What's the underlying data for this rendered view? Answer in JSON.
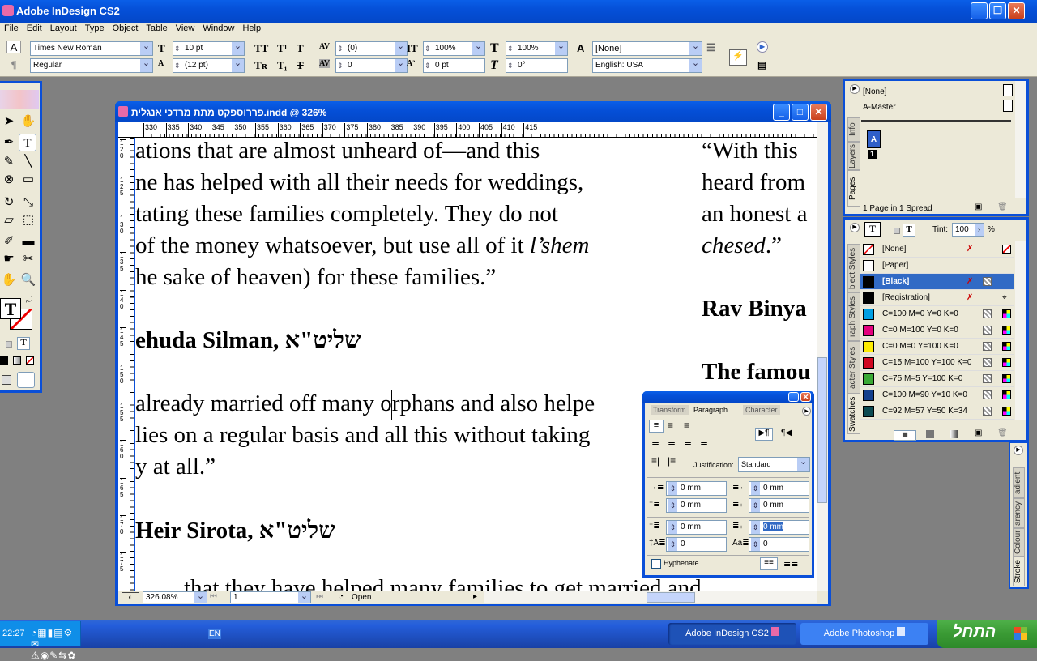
{
  "app": {
    "title": "Adobe InDesign CS2"
  },
  "menu": [
    "File",
    "Edit",
    "Layout",
    "Type",
    "Object",
    "Table",
    "View",
    "Window",
    "Help"
  ],
  "control": {
    "font": "Times New Roman",
    "style": "Regular",
    "size": "10 pt",
    "leading": "(12 pt)",
    "kerning": "(0)",
    "tracking": "0",
    "vscale": "100%",
    "baseline": "0 pt",
    "hscale": "100%",
    "skew": "0°",
    "char_style": "[None]",
    "language": "English: USA"
  },
  "document": {
    "title": "פררוספקט מתת מרדכי אנגלית.indd @ 326%",
    "hruler": [
      "330",
      "335",
      "340",
      "345",
      "350",
      "355",
      "360",
      "365",
      "370",
      "375",
      "380",
      "385",
      "390",
      "395",
      "400",
      "405",
      "410",
      "415"
    ],
    "vruler": [
      "120",
      "125",
      "130",
      "135",
      "140",
      "145",
      "150",
      "155",
      "160",
      "165",
      "170",
      "175"
    ],
    "left_lines": [
      "ations that are almost unheard of—and this",
      "ne has helped with all their needs for weddings,",
      "tating these families completely. They do not",
      " of the money whatsoever, but use all of it ",
      "he sake of heaven) for these families.”",
      "ehuda Silman, שליט\"א",
      "already married off many orphans and also helpe",
      "lies on a regular basis and all this without taking",
      "y at all.”",
      "Heir Sirota, שליט\"א",
      "that they have helped many families to get married and"
    ],
    "italic_word": "l’shem",
    "right_lines": [
      "“With this",
      "heard from",
      "an honest a",
      "chesed",
      ".”",
      "Rav Binya",
      "The famou"
    ],
    "zoom": "326.08%",
    "page": "1",
    "status": "Open"
  },
  "pages_panel": {
    "tabs": [
      "Pages",
      "Layers",
      "Info"
    ],
    "masters": [
      "[None]",
      "A-Master"
    ],
    "master_letter": "A",
    "page_num": "1",
    "footer": "1 Page in 1 Spread"
  },
  "swatches_panel": {
    "tabs": [
      "Swatches",
      "acter Styles",
      "raph Styles",
      "bject Styles"
    ],
    "tint_label": "Tint:",
    "tint": "100",
    "pct": "%",
    "items": [
      {
        "name": "[None]",
        "color": "#ffffff"
      },
      {
        "name": "[Paper]",
        "color": "#ffffff"
      },
      {
        "name": "[Black]",
        "color": "#000000"
      },
      {
        "name": "[Registration]",
        "color": "#000000"
      },
      {
        "name": "C=100 M=0 Y=0 K=0",
        "color": "#009fe3"
      },
      {
        "name": "C=0 M=100 Y=0 K=0",
        "color": "#e4007d"
      },
      {
        "name": "C=0 M=0 Y=100 K=0",
        "color": "#ffed00"
      },
      {
        "name": "C=15 M=100 Y=100 K=0",
        "color": "#d1081f"
      },
      {
        "name": "C=75 M=5 Y=100 K=0",
        "color": "#3aa935"
      },
      {
        "name": "C=100 M=90 Y=10 K=0",
        "color": "#123f8c"
      },
      {
        "name": "C=92 M=57 Y=50 K=34",
        "color": "#0b4a52"
      }
    ]
  },
  "right_tabs": [
    "Stroke",
    "Colour",
    "arency",
    "adient"
  ],
  "paragraph_panel": {
    "tabs": [
      "Transform",
      "Paragraph",
      "Character"
    ],
    "justification_label": "Justification:",
    "justification": "Standard",
    "left_indent": "0 mm",
    "right_indent": "0 mm",
    "first_indent": "0 mm",
    "last_indent": "0 mm",
    "space_before": "0 mm",
    "space_after": "0 mm",
    "drop_lines": "0",
    "drop_chars": "0",
    "hyphenate": "Hyphenate"
  },
  "taskbar": {
    "time": "22:27",
    "lang": "EN",
    "tasks": [
      "Adobe InDesign CS2",
      "Adobe Photoshop"
    ],
    "start": "התחל"
  }
}
